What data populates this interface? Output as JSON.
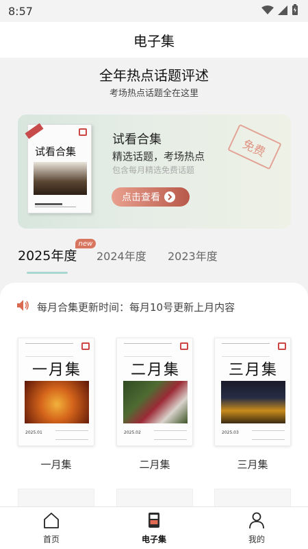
{
  "status_bar": {
    "time": "8:57"
  },
  "header": {
    "title": "电子集"
  },
  "hero": {
    "heading": "全年热点话题评述",
    "subheading": "考场热点话题全在这里"
  },
  "promo": {
    "book_title": "试看合集",
    "title": "试看合集",
    "line1": "精选话题，考场热点",
    "line2": "包含每月精选免费话题",
    "button_label": "点击查看",
    "stamp": "免费"
  },
  "year_tabs": {
    "badge": "new",
    "tabs": [
      {
        "label": "2025年度",
        "active": true
      },
      {
        "label": "2024年度",
        "active": false
      },
      {
        "label": "2023年度",
        "active": false
      }
    ]
  },
  "notice": {
    "text": "每月合集更新时间：每月10号更新上月内容"
  },
  "collections": [
    {
      "cover_title": "一月集",
      "cover_date": "2025.01",
      "label": "一月集"
    },
    {
      "cover_title": "二月集",
      "cover_date": "2025.02",
      "label": "二月集"
    },
    {
      "cover_title": "三月集",
      "cover_date": "2025.03",
      "label": "三月集"
    }
  ],
  "bottom_nav": {
    "items": [
      {
        "label": "首页",
        "icon": "home-icon",
        "active": false
      },
      {
        "label": "电子集",
        "icon": "ebook-icon",
        "active": true
      },
      {
        "label": "我的",
        "icon": "user-icon",
        "active": false
      }
    ]
  },
  "colors": {
    "accent_tab_underline": "#a8d7cf",
    "badge": "#d8755f",
    "button_start": "#e9a08e",
    "button_end": "#b8584a",
    "notice_icon": "#d96a4f"
  }
}
